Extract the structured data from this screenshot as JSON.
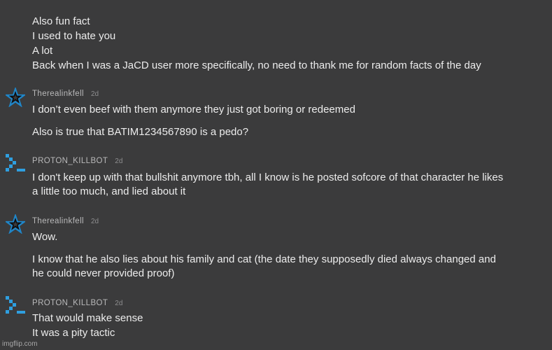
{
  "top_message": {
    "lines": [
      "Also fun fact",
      "I used to hate you",
      "A lot",
      "Back when I was a JaCD user more specifically, no need to thank me for random facts of the day"
    ]
  },
  "messages": [
    {
      "avatar": "star-icon",
      "username": "Therealinkfell",
      "time": "2d",
      "lines": [
        "I don’t even beef with them anymore they just got boring or redeemed",
        "Also is true that BATIM1234567890 is a pedo?"
      ]
    },
    {
      "avatar": "terminal-prompt-icon",
      "username": "PROTON_KILLBOT",
      "time": "2d",
      "lines": [
        "I don't keep up with that bullshit anymore tbh, all I know is he posted sofcore of that character he likes",
        "a little too much, and lied about it"
      ]
    },
    {
      "avatar": "star-icon",
      "username": "Therealinkfell",
      "time": "2d",
      "lines": [
        "Wow.",
        "I know that he also lies about his family and cat (the date they supposedly died always changed and",
        "he could never provided proof)"
      ]
    },
    {
      "avatar": "terminal-prompt-icon",
      "username": "PROTON_KILLBOT",
      "time": "2d",
      "lines": [
        "That would make sense",
        "It was a pity tactic"
      ]
    }
  ],
  "watermark": "imgflip.com",
  "colors": {
    "background": "#3b3b3c",
    "text": "#ececec",
    "username": "#b9b9ba",
    "star_icon": "#1f86c9",
    "prompt_icon": "#2f9fe0"
  }
}
